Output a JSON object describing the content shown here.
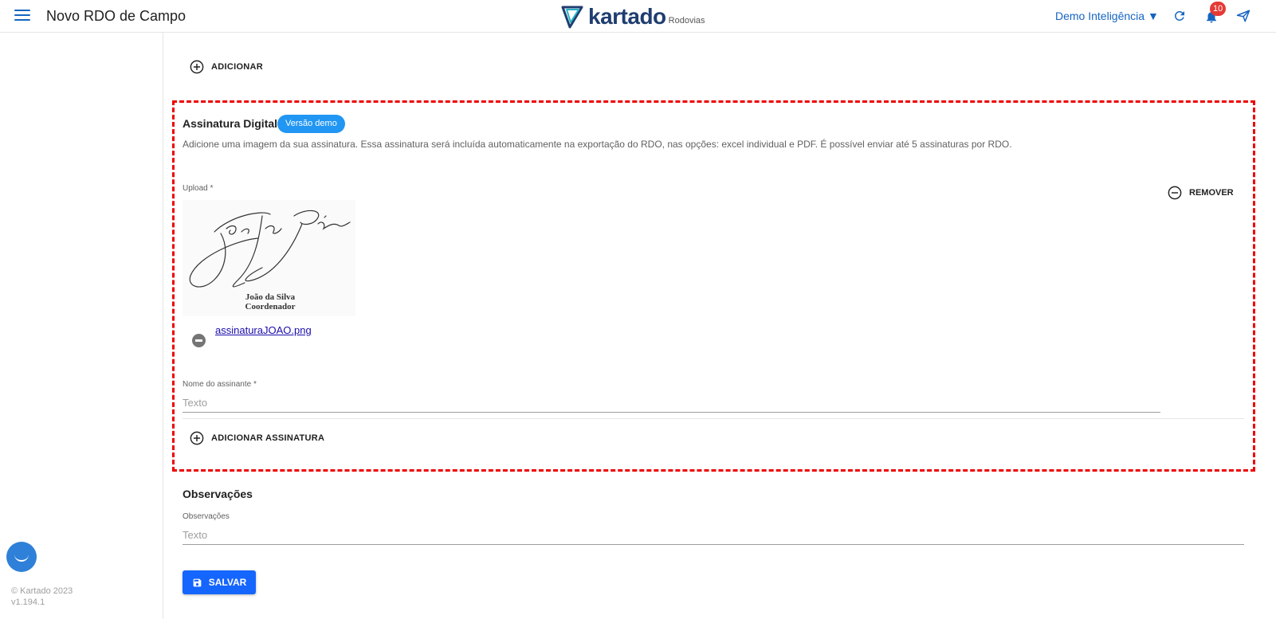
{
  "header": {
    "title": "Novo RDO de Campo",
    "logo_word": "kartado",
    "logo_sub": "Rodovias",
    "user_menu": "Demo Inteligência ▼",
    "notification_count": "10"
  },
  "sidebar": {
    "copyright": "© Kartado 2023",
    "version": "v1.194.1"
  },
  "content": {
    "add_label": "ADICIONAR",
    "signature": {
      "title": "Assinatura Digital",
      "badge": "Versão demo",
      "description": "Adicione uma imagem da sua assinatura. Essa assinatura será incluída automaticamente na exportação do RDO, nas opções: excel individual e PDF. É possível enviar até 5 assinaturas por RDO.",
      "upload_label": "Upload *",
      "remove_label": "REMOVER",
      "image_name_line": "João da Silva",
      "image_role_line": "Coordenador",
      "file_name": "assinaturaJOAO.png",
      "signer_label": "Nome do assinante *",
      "signer_placeholder": "Texto",
      "add_signature_label": "ADICIONAR ASSINATURA"
    },
    "observations": {
      "title": "Observações",
      "label": "Observações",
      "placeholder": "Texto"
    },
    "save_label": "SALVAR"
  },
  "colors": {
    "accent": "#1565c0",
    "primary_button": "#1565ff",
    "badge": "#2196f3",
    "highlight_border": "#ee0000",
    "notification": "#e53935"
  }
}
